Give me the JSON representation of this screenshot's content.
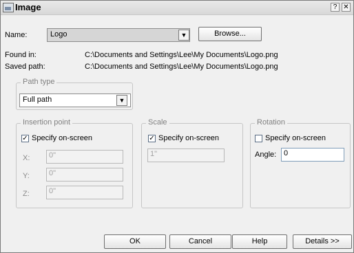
{
  "window": {
    "title": "Image",
    "help_icon": "?",
    "close_icon": "✕"
  },
  "name_row": {
    "label": "Name:",
    "value": "Logo",
    "browse_label": "Browse..."
  },
  "info": {
    "found_label": "Found in:",
    "found_value": "C:\\Documents and Settings\\Lee\\My Documents\\Logo.png",
    "saved_label": "Saved path:",
    "saved_value": "C:\\Documents and Settings\\Lee\\My Documents\\Logo.png"
  },
  "path_type": {
    "label": "Path type",
    "value": "Full path"
  },
  "insertion": {
    "label": "Insertion point",
    "specify_label": "Specify on-screen",
    "specify_checked": true,
    "x_label": "X:",
    "x_value": "0\"",
    "y_label": "Y:",
    "y_value": "0\"",
    "z_label": "Z:",
    "z_value": "0\""
  },
  "scale": {
    "label": "Scale",
    "specify_label": "Specify on-screen",
    "specify_checked": true,
    "value": "1\""
  },
  "rotation": {
    "label": "Rotation",
    "specify_label": "Specify on-screen",
    "specify_checked": false,
    "angle_label": "Angle:",
    "angle_value": "0"
  },
  "buttons": {
    "ok": "OK",
    "cancel": "Cancel",
    "help": "Help",
    "details": "Details >>"
  }
}
